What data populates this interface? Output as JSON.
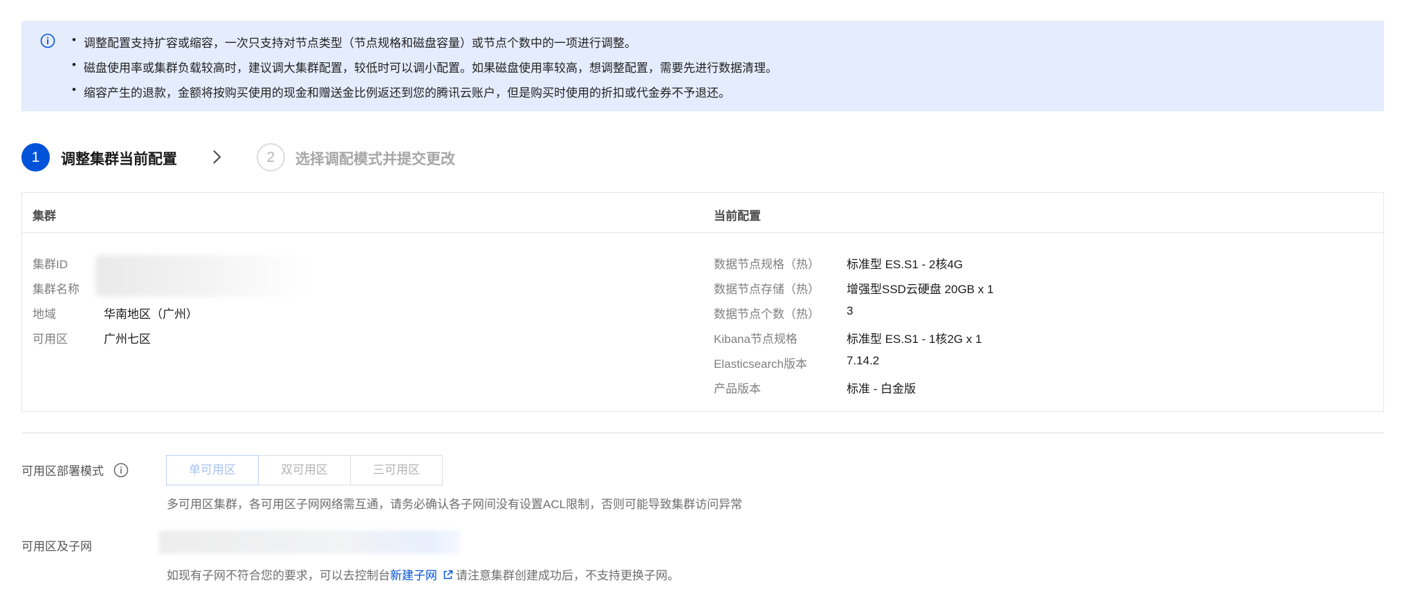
{
  "notice": {
    "lines": [
      "调整配置支持扩容或缩容，一次只支持对节点类型（节点规格和磁盘容量）或节点个数中的一项进行调整。",
      "磁盘使用率或集群负载较高时，建议调大集群配置，较低时可以调小配置。如果磁盘使用率较高，想调整配置，需要先进行数据清理。",
      "缩容产生的退款，金额将按购买使用的现金和赠送金比例返还到您的腾讯云账户，但是购买时使用的折扣或代金券不予退还。"
    ]
  },
  "steps": [
    {
      "number": "1",
      "label": "调整集群当前配置"
    },
    {
      "number": "2",
      "label": "选择调配模式并提交更改"
    }
  ],
  "cluster_panel": {
    "left_header": "集群",
    "right_header": "当前配置",
    "left_fields": [
      {
        "key": "集群ID",
        "value": ""
      },
      {
        "key": "集群名称",
        "value": ""
      },
      {
        "key": "地域",
        "value": "华南地区（广州）"
      },
      {
        "key": "可用区",
        "value": "广州七区"
      }
    ],
    "right_fields": [
      {
        "key": "数据节点规格（热）",
        "value": "标准型 ES.S1 - 2核4G"
      },
      {
        "key": "数据节点存储（热）",
        "value": "增强型SSD云硬盘 20GB x 1"
      },
      {
        "key": "数据节点个数（热）",
        "value": "3"
      },
      {
        "key": "Kibana节点规格",
        "value": "标准型 ES.S1 - 1核2G x 1"
      },
      {
        "key": "Elasticsearch版本",
        "value": "7.14.2"
      },
      {
        "key": "产品版本",
        "value": "标准 - 白金版"
      }
    ]
  },
  "az_mode": {
    "label": "可用区部署模式",
    "options": [
      "单可用区",
      "双可用区",
      "三可用区"
    ],
    "selected": "单可用区",
    "hint": "多可用区集群，各可用区子网网络需互通，请务必确认各子网间没有设置ACL限制，否则可能导致集群访问异常"
  },
  "subnet": {
    "label": "可用区及子网",
    "hint_prefix": "如现有子网不符合您的要求，可以去控制台",
    "link_text": "新建子网",
    "hint_suffix": "请注意集群创建成功后，不支持更换子网。"
  },
  "colors": {
    "primary": "#0052d9",
    "notice_bg": "#e5ecfd"
  }
}
